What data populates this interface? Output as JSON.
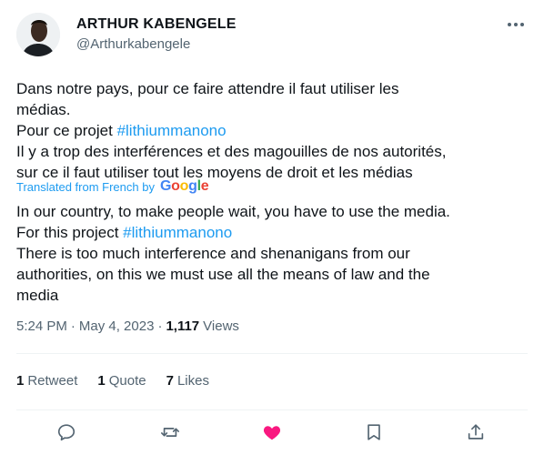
{
  "author": {
    "name": "ARTHUR KABENGELE",
    "handle": "@Arthurkabengele"
  },
  "tweet": {
    "original_lines": [
      "Dans notre pays,  pour ce faire attendre il faut utiliser les",
      "médias.",
      "Pour ce projet",
      "Il y a trop des interférences et des magouilles de nos autorités,",
      "sur ce il faut utiliser tout les moyens de droit et les médias"
    ],
    "hashtag": "#lithiummanono",
    "translated_label": "Translated from French by",
    "google_letters": [
      "G",
      "o",
      "o",
      "g",
      "l",
      "e"
    ],
    "translation_lines": [
      "In our country, to make people wait, you have to use the media.",
      "For this project",
      "There is too much interference and shenanigans from our",
      "authorities, on this we must use all the means of law and the",
      "media"
    ]
  },
  "meta": {
    "time": "5:24 PM",
    "separator": "·",
    "date": "May 4, 2023",
    "views_count": "1,117",
    "views_label": "Views"
  },
  "stats": {
    "retweets_count": "1",
    "retweets_label": "Retweet",
    "quotes_count": "1",
    "quotes_label": "Quote",
    "likes_count": "7",
    "likes_label": "Likes"
  },
  "icons": {
    "more": "more-horizontal-icon",
    "reply": "reply-icon",
    "retweet": "retweet-icon",
    "like": "heart-icon",
    "bookmark": "bookmark-icon",
    "share": "share-icon"
  },
  "colors": {
    "accent": "#1d9bf0",
    "like": "#f91880",
    "muted": "#536471",
    "text": "#0f1419"
  }
}
